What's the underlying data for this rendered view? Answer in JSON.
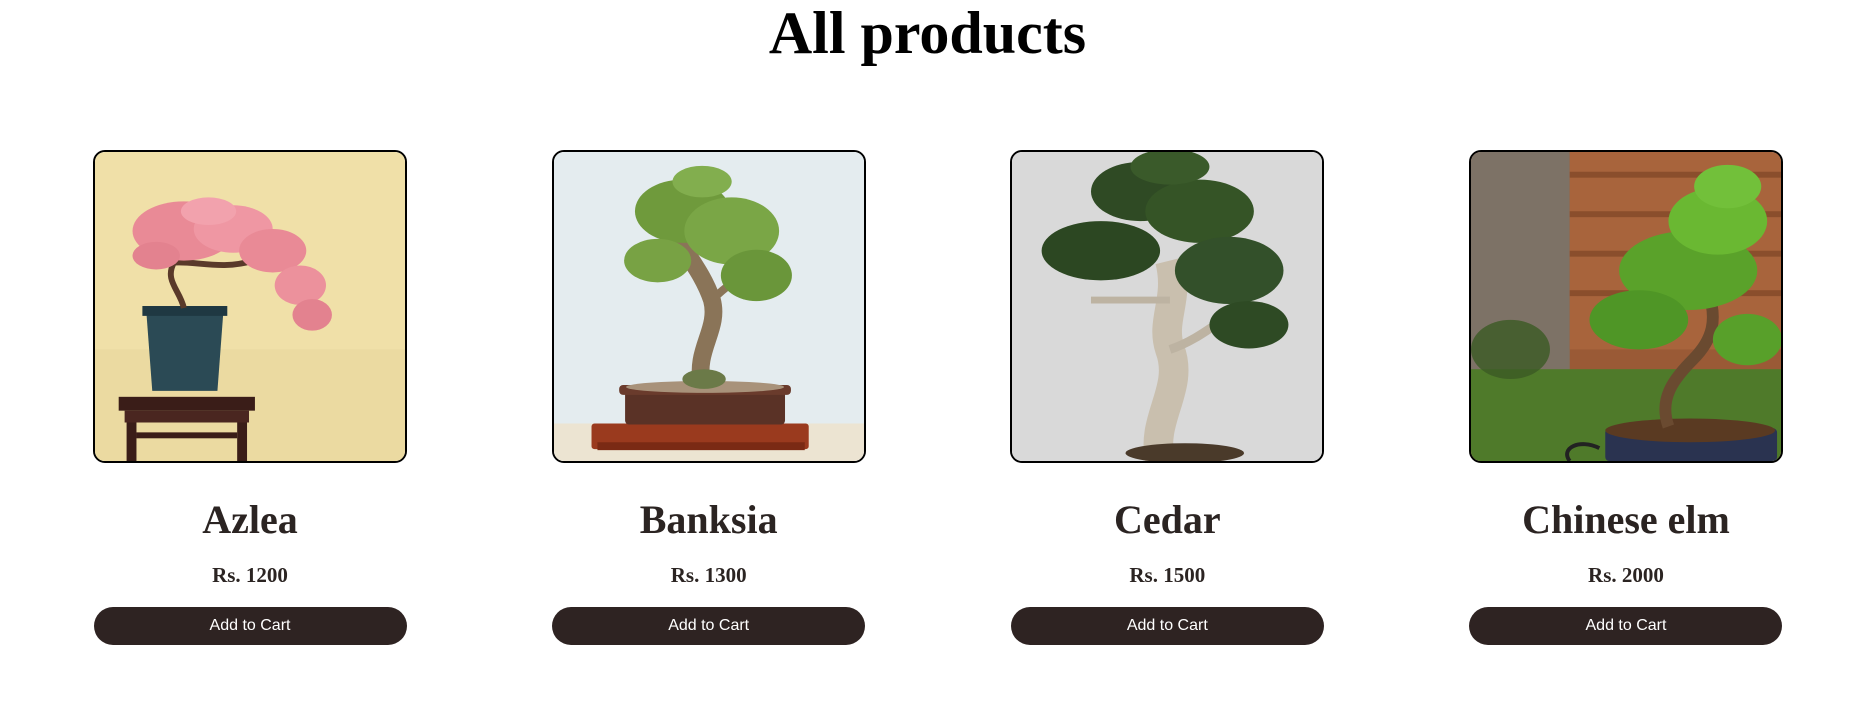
{
  "page": {
    "title": "All products"
  },
  "products": [
    {
      "name": "Azlea",
      "price": "Rs. 1200",
      "button": "Add to Cart",
      "image": "azalea-bonsai-photo"
    },
    {
      "name": "Banksia",
      "price": "Rs. 1300",
      "button": "Add to Cart",
      "image": "banksia-bonsai-photo"
    },
    {
      "name": "Cedar",
      "price": "Rs. 1500",
      "button": "Add to Cart",
      "image": "cedar-bonsai-photo"
    },
    {
      "name": "Chinese elm",
      "price": "Rs. 2000",
      "button": "Add to Cart",
      "image": "chinese-elm-bonsai-photo"
    }
  ],
  "colors": {
    "text": "#2b2422",
    "button_bg": "#2e2322",
    "button_text": "#ffffff",
    "card_border": "#000000"
  }
}
